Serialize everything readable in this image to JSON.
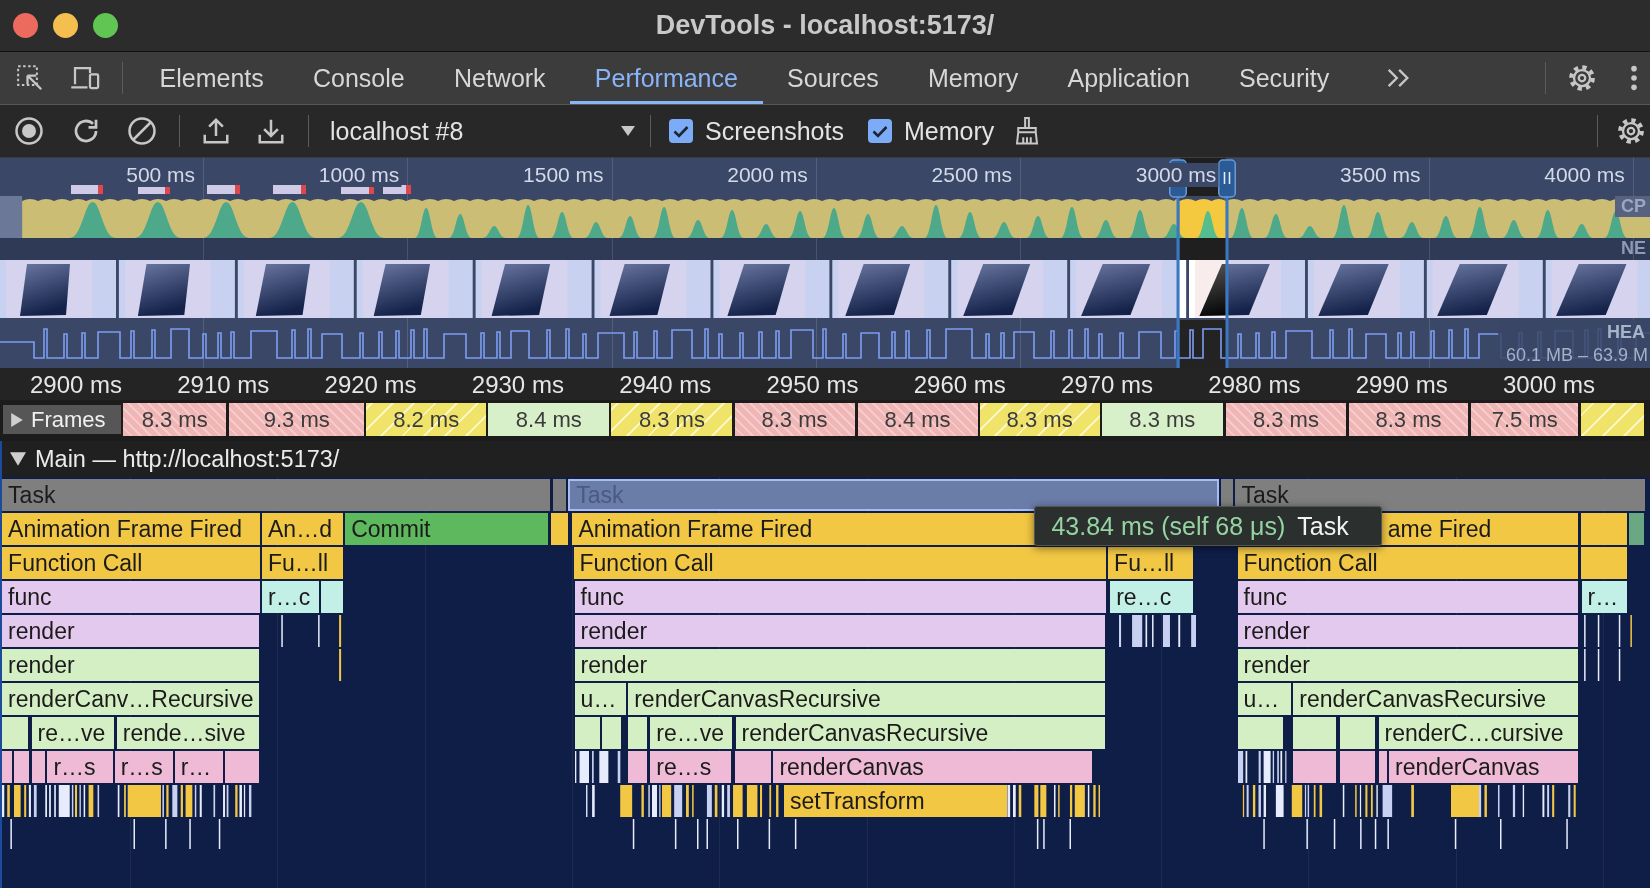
{
  "window": {
    "title": "DevTools - localhost:5173/"
  },
  "tabs": [
    {
      "label": "Elements",
      "selected": false
    },
    {
      "label": "Console",
      "selected": false
    },
    {
      "label": "Network",
      "selected": false
    },
    {
      "label": "Performance",
      "selected": true
    },
    {
      "label": "Sources",
      "selected": false
    },
    {
      "label": "Memory",
      "selected": false
    },
    {
      "label": "Application",
      "selected": false
    },
    {
      "label": "Security",
      "selected": false
    }
  ],
  "toolbar": {
    "recording": "localhost #8",
    "checkboxes": [
      {
        "label": "Screenshots",
        "checked": true
      },
      {
        "label": "Memory",
        "checked": true
      }
    ]
  },
  "overview": {
    "ticks": [
      "500 ms",
      "1000 ms",
      "1500 ms",
      "2000 ms",
      "2500 ms",
      "3000 ms",
      "3500 ms",
      "4000 ms"
    ],
    "cpu_label": "CP",
    "net_label": "NE",
    "heap_label": "HEA",
    "heap_range": "60.1 MB – 63.9 M"
  },
  "timeline": {
    "ticks": [
      "2900 ms",
      "2910 ms",
      "2920 ms",
      "2930 ms",
      "2940 ms",
      "2950 ms",
      "2960 ms",
      "2970 ms",
      "2980 ms",
      "2990 ms",
      "3000 ms"
    ]
  },
  "frames": {
    "label": "Frames",
    "expanded": false,
    "items": [
      {
        "duration": "8.3 ms",
        "kind": "dropped"
      },
      {
        "duration": "9.3 ms",
        "kind": "dropped"
      },
      {
        "duration": "8.2 ms",
        "kind": "partial"
      },
      {
        "duration": "8.4 ms",
        "kind": "complete"
      },
      {
        "duration": "8.3 ms",
        "kind": "partial"
      },
      {
        "duration": "8.3 ms",
        "kind": "dropped"
      },
      {
        "duration": "8.4 ms",
        "kind": "dropped"
      },
      {
        "duration": "8.3 ms",
        "kind": "partial"
      },
      {
        "duration": "8.3 ms",
        "kind": "complete"
      },
      {
        "duration": "8.3 ms",
        "kind": "dropped"
      },
      {
        "duration": "8.3 ms",
        "kind": "dropped"
      },
      {
        "duration": "7.5 ms",
        "kind": "dropped"
      },
      {
        "kind": "partial"
      }
    ]
  },
  "main_track": {
    "title": "Main — http://localhost:5173/",
    "expanded": true,
    "rows": [
      {
        "entries": [
          {
            "label": "Task",
            "color": "#7f7f7f",
            "selected": false
          },
          {
            "color": "#7f7f7f",
            "selected": false
          },
          {
            "label": "Task",
            "color": "#6a7ca8",
            "selected": true
          },
          {
            "color": "#7f7f7f",
            "selected": false
          },
          {
            "label": "Task",
            "color": "#7f7f7f",
            "selected": false
          }
        ]
      },
      {
        "entries": [
          {
            "label": "Animation Frame Fired",
            "color": "#f2c744",
            "selected": false
          },
          {
            "label": "An…d",
            "color": "#f2c744",
            "selected": false
          },
          {
            "label": "Commit",
            "color": "#5eb85e",
            "selected": false
          },
          {
            "color": "#f2c744",
            "selected": false
          },
          {
            "label": "Animation Frame Fired",
            "color": "#f2c744",
            "selected": false
          },
          {
            "label": "ame Fired",
            "color": "#f2c744",
            "selected": false
          },
          {
            "color": "#f2c744",
            "selected": false
          },
          {
            "color": "#6aa884",
            "selected": false
          }
        ]
      },
      {
        "entries": [
          {
            "label": "Function Call",
            "color": "#f2c744",
            "selected": false
          },
          {
            "label": "Fu…ll",
            "color": "#f2c744",
            "selected": false
          },
          {
            "label": "Function Call",
            "color": "#f2c744",
            "selected": false
          },
          {
            "label": "Fu…ll",
            "color": "#f2c744",
            "selected": false
          },
          {
            "label": "Function Call",
            "color": "#f2c744",
            "selected": false
          },
          {
            "color": "#f2c744",
            "selected": false
          }
        ]
      },
      {
        "entries": [
          {
            "label": "func",
            "color": "#e4c9ee",
            "selected": false
          },
          {
            "label": "r…c",
            "color": "#c2f0e6",
            "selected": false
          },
          {
            "color": "#c2f0e6",
            "selected": false
          },
          {
            "label": "func",
            "color": "#e4c9ee",
            "selected": false
          },
          {
            "label": "re…c",
            "color": "#c2f0e6",
            "selected": false
          },
          {
            "label": "func",
            "color": "#e4c9ee",
            "selected": false
          },
          {
            "label": "r…",
            "color": "#c2f0e6",
            "selected": false
          }
        ]
      },
      {
        "entries": [
          {
            "label": "render",
            "color": "#e4c9ee",
            "selected": false
          },
          {
            "label": "render",
            "color": "#e4c9ee",
            "selected": false
          },
          {
            "label": "render",
            "color": "#e4c9ee",
            "selected": false
          }
        ]
      },
      {
        "entries": [
          {
            "label": "render",
            "color": "#d5efc5",
            "selected": false
          },
          {
            "label": "render",
            "color": "#d5efc5",
            "selected": false
          },
          {
            "label": "render",
            "color": "#d5efc5",
            "selected": false
          }
        ]
      },
      {
        "entries": [
          {
            "label": "renderCanv…Recursive",
            "color": "#d5efc5",
            "selected": false
          },
          {
            "label": "u…",
            "color": "#d5efc5",
            "selected": false
          },
          {
            "label": "renderCanvasRecursive",
            "color": "#d5efc5",
            "selected": false
          },
          {
            "label": "u…",
            "color": "#d5efc5",
            "selected": false
          },
          {
            "label": "renderCanvasRecursive",
            "color": "#d5efc5",
            "selected": false
          }
        ]
      },
      {
        "entries": [
          {
            "color": "#d5efc5",
            "selected": false
          },
          {
            "label": "re…ve",
            "color": "#d5efc5",
            "selected": false
          },
          {
            "label": "rende…sive",
            "color": "#d5efc5",
            "selected": false
          },
          {
            "color": "#d5efc5",
            "selected": false
          },
          {
            "color": "#d5efc5",
            "selected": false
          },
          {
            "color": "#d5efc5",
            "selected": false
          },
          {
            "label": "re…ve",
            "color": "#d5efc5",
            "selected": false
          },
          {
            "label": "renderCanvasRecursive",
            "color": "#d5efc5",
            "selected": false
          },
          {
            "color": "#d5efc5",
            "selected": false
          },
          {
            "color": "#d5efc5",
            "selected": false
          },
          {
            "color": "#d5efc5",
            "selected": false
          },
          {
            "label": "renderC…cursive",
            "color": "#d5efc5",
            "selected": false
          }
        ]
      },
      {
        "entries": [
          {
            "color": "#eebad6",
            "selected": false
          },
          {
            "color": "#eebad6",
            "selected": false
          },
          {
            "color": "#eebad6",
            "selected": false
          },
          {
            "label": "r…s",
            "color": "#eebad6",
            "selected": false
          },
          {
            "label": "r…s",
            "color": "#eebad6",
            "selected": false
          },
          {
            "label": "r…",
            "color": "#eebad6",
            "selected": false
          },
          {
            "color": "#eebad6",
            "selected": false
          },
          {
            "color": "#eebad6",
            "selected": false
          },
          {
            "label": "re…s",
            "color": "#eebad6",
            "selected": false
          },
          {
            "color": "#eebad6",
            "selected": false
          },
          {
            "label": "renderCanvas",
            "color": "#eebad6",
            "selected": false
          },
          {
            "color": "#eebad6",
            "selected": false
          },
          {
            "color": "#eebad6",
            "selected": false
          },
          {
            "color": "#eebad6",
            "selected": false
          },
          {
            "label": "renderCanvas",
            "color": "#eebad6",
            "selected": false
          }
        ]
      },
      {
        "entries": [
          {
            "color": "#f2c744",
            "selected": false
          },
          {
            "label": "setTransform",
            "color": "#f2c744",
            "selected": false
          },
          {
            "color": "#f2c744",
            "selected": false
          }
        ]
      }
    ]
  },
  "tooltip": {
    "duration": "43.84 ms (self 68 μs)",
    "name": "Task"
  }
}
